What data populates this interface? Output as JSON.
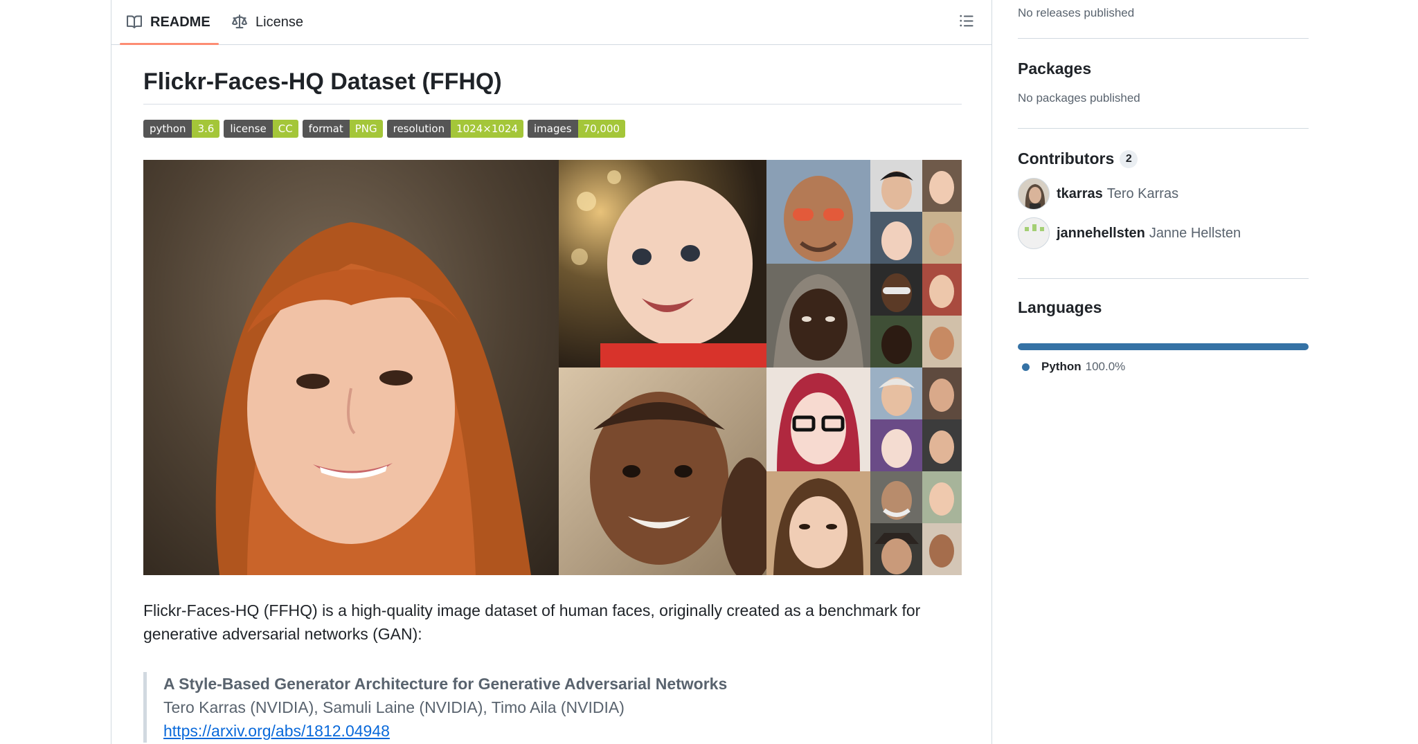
{
  "tabs": {
    "readme_label": "README",
    "license_label": "License",
    "readme_icon": "book-icon",
    "license_icon": "law-icon",
    "outline_icon": "list-unordered-icon"
  },
  "readme": {
    "title": "Flickr-Faces-HQ Dataset (FFHQ)",
    "badges": [
      {
        "label": "python",
        "value": "3.6",
        "color": "#a4c639"
      },
      {
        "label": "license",
        "value": "CC",
        "color": "#a4c639"
      },
      {
        "label": "format",
        "value": "PNG",
        "color": "#a4c639"
      },
      {
        "label": "resolution",
        "value": "1024×1024",
        "color": "#a4c639"
      },
      {
        "label": "images",
        "value": "70,000",
        "color": "#a4c639"
      }
    ],
    "intro": "Flickr-Faces-HQ (FFHQ) is a high-quality image dataset of human faces, originally created as a benchmark for generative adversarial networks (GAN):",
    "paper_title": "A Style-Based Generator Architecture for Generative Adversarial Networks",
    "paper_authors": "Tero Karras (NVIDIA), Samuli Laine (NVIDIA), Timo Aila (NVIDIA)",
    "paper_link": "https://arxiv.org/abs/1812.04948"
  },
  "sidebar": {
    "releases_empty": "No releases published",
    "packages_title": "Packages",
    "packages_empty": "No packages published",
    "contributors_title": "Contributors",
    "contributors_count": "2",
    "contributors": [
      {
        "login": "tkarras",
        "name": "Tero Karras"
      },
      {
        "login": "jannehellsten",
        "name": "Janne Hellsten"
      }
    ],
    "languages_title": "Languages",
    "languages": [
      {
        "name": "Python",
        "percent": "100.0%",
        "color": "#3572a5"
      }
    ]
  }
}
